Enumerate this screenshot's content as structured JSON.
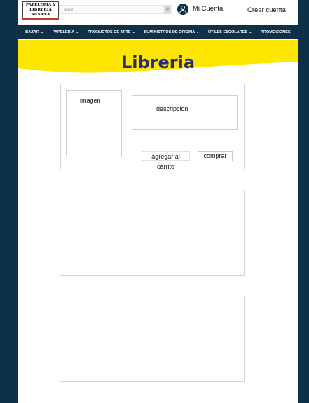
{
  "header": {
    "logo_lines": [
      "PAPELERIA Y",
      "LIBRERIA",
      "SUSANA"
    ],
    "search": {
      "placeholder": "Buscar"
    },
    "account_label": "Mi Cuenta",
    "create_account_label": "Crear cuenta"
  },
  "nav": {
    "items": [
      {
        "label": "BAZAR",
        "has_dropdown": true
      },
      {
        "label": "PAPELERÍA",
        "has_dropdown": true
      },
      {
        "label": "PRODUCTOS DE ARTE",
        "has_dropdown": true
      },
      {
        "label": "SUMINISTROS DE OFICINA",
        "has_dropdown": true
      },
      {
        "label": "ÚTILES ESCOLARES",
        "has_dropdown": true
      },
      {
        "label": "PROMOCIONES",
        "has_dropdown": false
      }
    ],
    "chevron": "⌄"
  },
  "banner": {
    "title": "Libreria"
  },
  "product": {
    "image_label": "imagen",
    "description_label": "descripcion",
    "add_to_cart_label": "agregar al carrito",
    "buy_label": "comprar"
  },
  "colors": {
    "navy": "#0f3049",
    "banner_yellow": "#ffe600",
    "title_purple": "#2b2d6e",
    "logo_underline": "#c0392b"
  },
  "icons": {
    "search": "search-icon",
    "account": "user-circle-icon"
  }
}
